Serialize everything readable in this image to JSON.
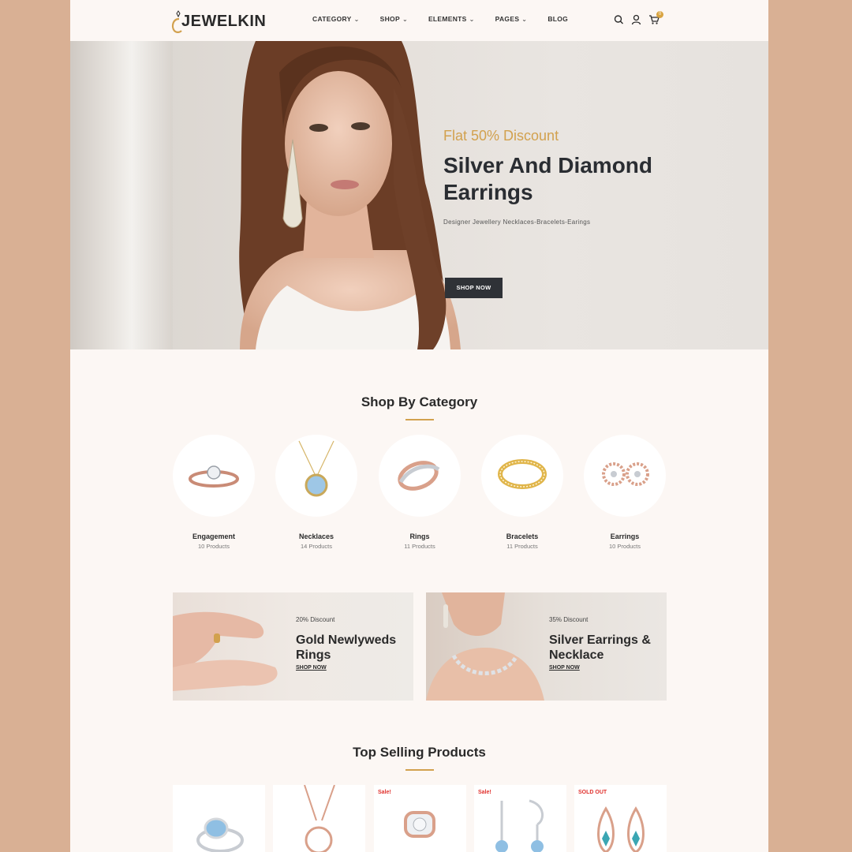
{
  "brand": {
    "name": "JEWELKIN",
    "accent": "#d2a14e",
    "dark": "#2f3237"
  },
  "nav": [
    {
      "label": "CATEGORY",
      "dropdown": true
    },
    {
      "label": "SHOP",
      "dropdown": true
    },
    {
      "label": "ELEMENTS",
      "dropdown": true
    },
    {
      "label": "PAGES",
      "dropdown": true
    },
    {
      "label": "BLOG",
      "dropdown": false
    }
  ],
  "header_icons": [
    "search-icon",
    "user-icon",
    "cart-icon"
  ],
  "cart": {
    "count": "0"
  },
  "hero": {
    "subtitle": "Flat 50% Discount",
    "title": "Silver And Diamond Earrings",
    "description": "Designer Jewellery Necklaces-Bracelets-Earings",
    "button": "SHOP NOW"
  },
  "categories_section": {
    "title": "Shop By Category",
    "items": [
      {
        "name": "Engagement",
        "count": "10 Products"
      },
      {
        "name": "Necklaces",
        "count": "14 Products"
      },
      {
        "name": "Rings",
        "count": "11 Products"
      },
      {
        "name": "Bracelets",
        "count": "11 Products"
      },
      {
        "name": "Earrings",
        "count": "10 Products"
      }
    ]
  },
  "banners": [
    {
      "discount": "20% Discount",
      "title": "Gold Newlyweds Rings",
      "link": "SHOP NOW"
    },
    {
      "discount": "35% Discount",
      "title": "Silver Earrings & Necklace",
      "link": "SHOP NOW"
    }
  ],
  "top_selling": {
    "title": "Top Selling Products",
    "products": [
      {
        "tag": ""
      },
      {
        "tag": ""
      },
      {
        "tag": "Sale!"
      },
      {
        "tag": "Sale!"
      },
      {
        "tag": "SOLD OUT"
      }
    ]
  }
}
